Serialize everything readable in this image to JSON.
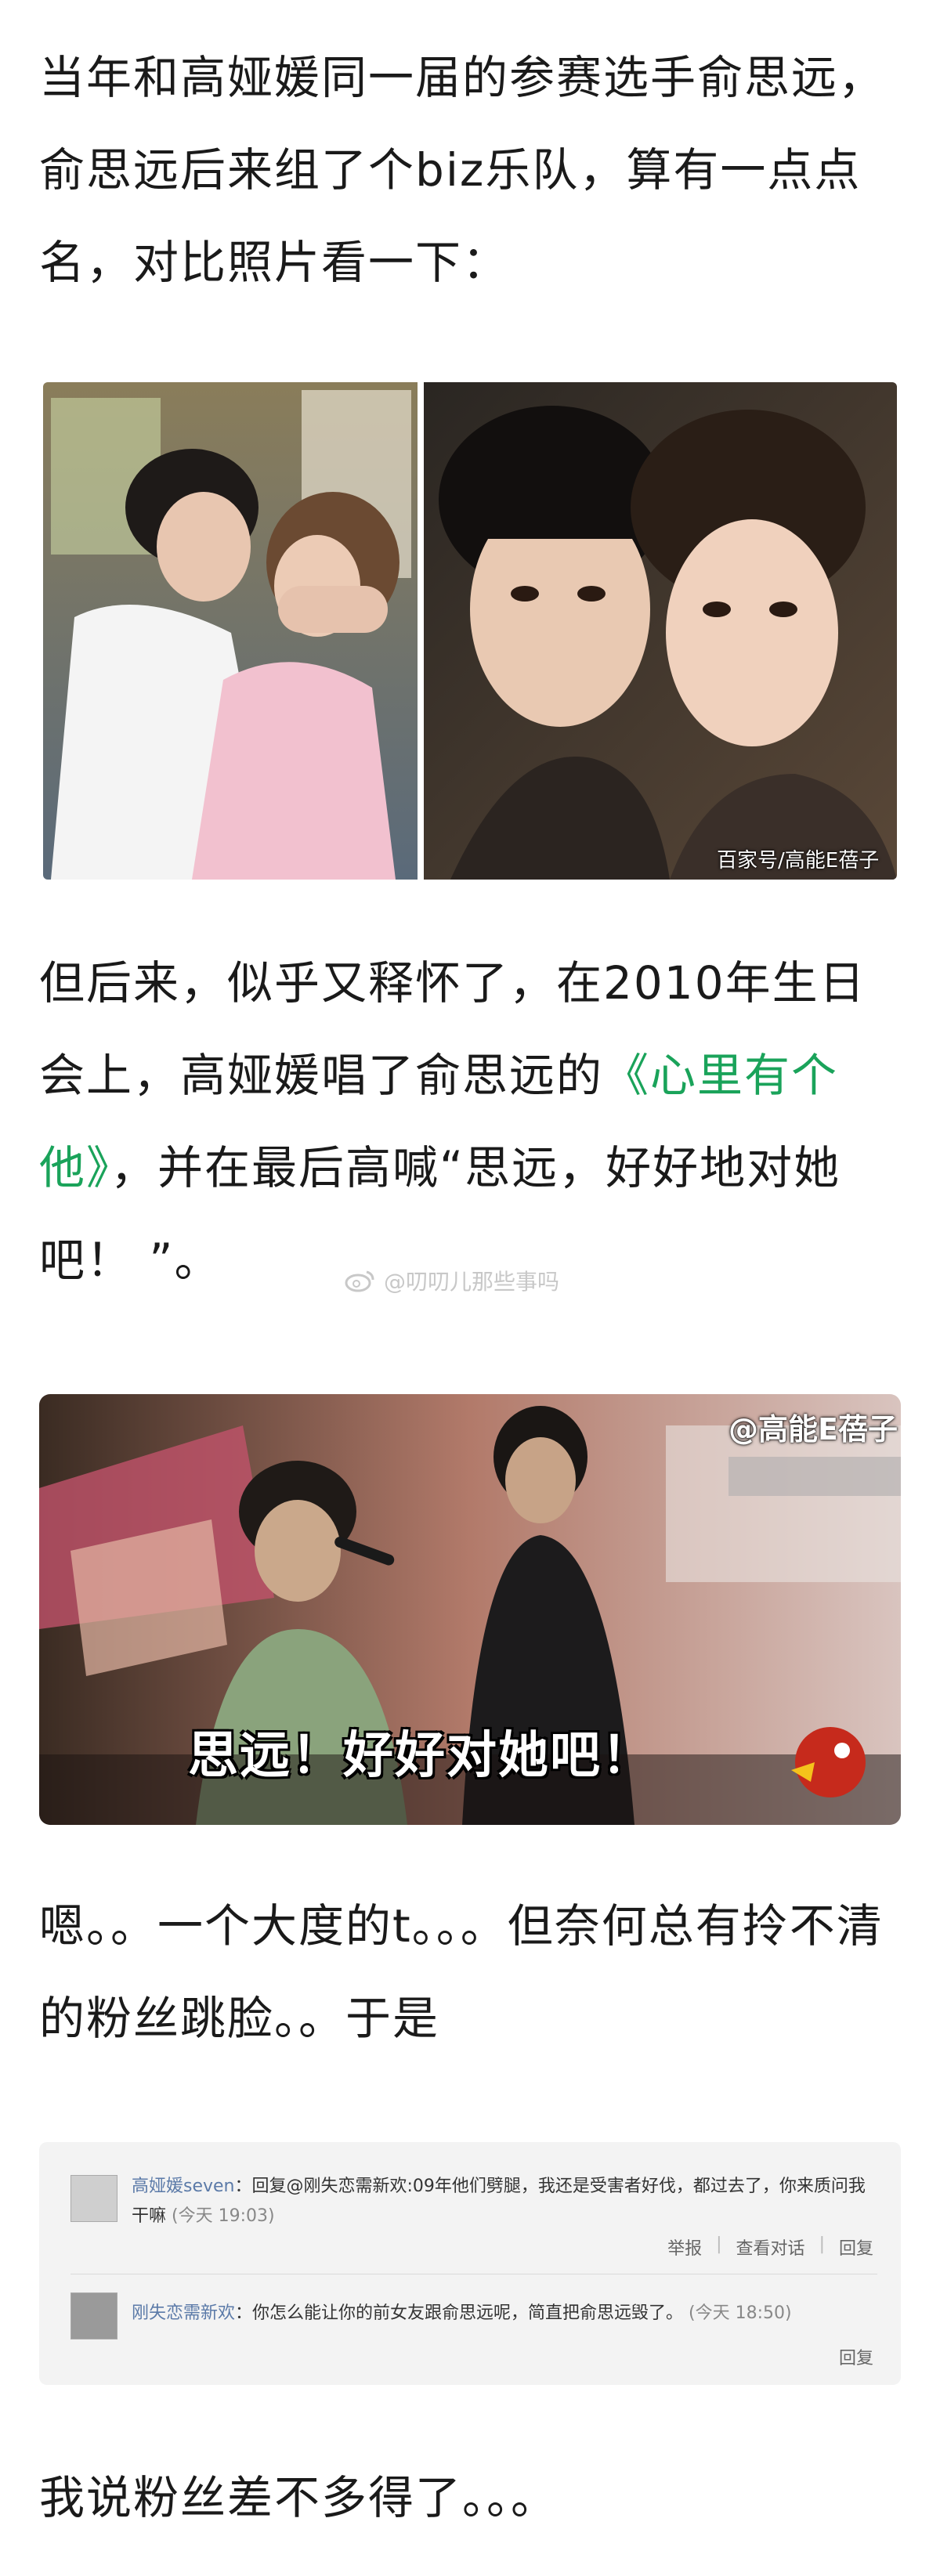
{
  "paragraphs": {
    "p1": "当年和高娅媛同一届的参赛选手俞思远，俞思远后来组了个biz乐队，算有一点点名，对比照片看一下：",
    "p2_before": "但后来，似乎又释怀了，在2010年生日会上，高娅媛唱了俞思远的",
    "p2_link": "《心里有个他》",
    "p2_after": "，并在最后高喊“思远，好好地对她吧！ ”。",
    "p3": "嗯。。一个大度的t。。。但奈何总有拎不清的粉丝跳脸。。于是",
    "p4": "我说粉丝差不多得了。。。"
  },
  "watermark": "@叨叨儿那些事吗",
  "photo1": {
    "credit": "百家号/高能E蓓子"
  },
  "photo2": {
    "credit": "@高能E蓓子",
    "caption": "思远！好好对她吧！"
  },
  "comments": [
    {
      "name": "高娅媛seven",
      "text": "：回复@刚失恋需新欢:09年他们劈腿，我还是受害者好伐，都过去了，你来质问我干嘛",
      "time": "(今天 19:03)",
      "actions": [
        "举报",
        "查看对话",
        "回复"
      ]
    },
    {
      "name": "刚失恋需新欢",
      "text": "：你怎么能让你的前女友跟俞思远呢，简直把俞思远毁了。",
      "time": "(今天 18:50)",
      "actions": [
        "回复"
      ]
    }
  ],
  "colors": {
    "link": "#1aa35a",
    "text": "#1a1a1a"
  }
}
